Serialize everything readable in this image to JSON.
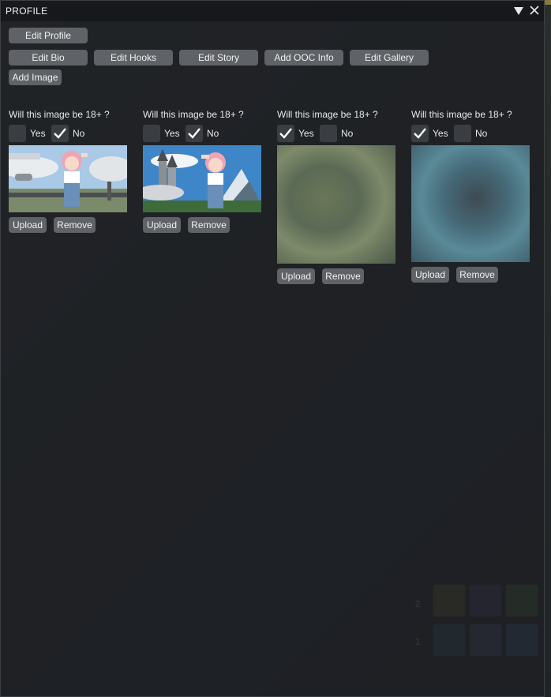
{
  "window": {
    "title": "PROFILE",
    "collapse_icon": "triangle-down-icon",
    "close_icon": "close-icon"
  },
  "buttons": {
    "edit_profile": "Edit Profile",
    "edit_bio": "Edit Bio",
    "edit_hooks": "Edit Hooks",
    "edit_story": "Edit Story",
    "add_ooc_info": "Add OOC Info",
    "edit_gallery": "Edit Gallery",
    "add_image": "Add Image"
  },
  "gallery": [
    {
      "question": "Will this image be 18+ ?",
      "yes_label": "Yes",
      "no_label": "No",
      "yes_checked": false,
      "no_checked": true,
      "upload": "Upload",
      "remove": "Remove",
      "image": "pink-haired-girl-with-airplane",
      "blurred": false
    },
    {
      "question": "Will this image be 18+ ?",
      "yes_label": "Yes",
      "no_label": "No",
      "yes_checked": false,
      "no_checked": true,
      "upload": "Upload",
      "remove": "Remove",
      "image": "pink-haired-girl-with-castle",
      "blurred": false
    },
    {
      "question": "Will this image be 18+ ?",
      "yes_label": "Yes",
      "no_label": "No",
      "yes_checked": true,
      "no_checked": false,
      "upload": "Upload",
      "remove": "Remove",
      "image": "blurred-image",
      "blurred": true
    },
    {
      "question": "Will this image be 18+ ?",
      "yes_label": "Yes",
      "no_label": "No",
      "yes_checked": true,
      "no_checked": false,
      "upload": "Upload",
      "remove": "Remove",
      "image": "blurred-image",
      "blurred": true
    }
  ],
  "hotbar": {
    "row_numbers": [
      "2",
      "1"
    ]
  },
  "colors": {
    "panel_bg": "#1e2024",
    "button_bg": "#5f6267",
    "checkbox_bg": "#3a3d42",
    "text": "#e8e8e8"
  }
}
